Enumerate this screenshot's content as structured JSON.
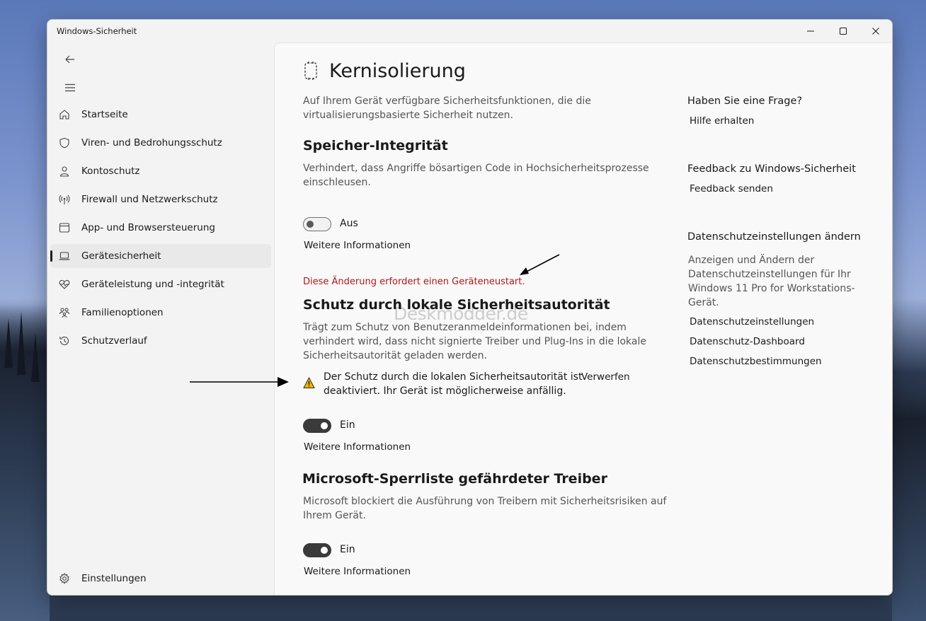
{
  "window": {
    "title": "Windows-Sicherheit",
    "controls": [
      "minimize-icon",
      "maximize-icon",
      "close-icon"
    ]
  },
  "nav": {
    "back_icon": "back-arrow-icon",
    "menu_icon": "hamburger-menu-icon",
    "items": [
      {
        "label": "Startseite",
        "icon": "home-icon"
      },
      {
        "label": "Viren- und Bedrohungsschutz",
        "icon": "shield-icon"
      },
      {
        "label": "Kontoschutz",
        "icon": "person-icon"
      },
      {
        "label": "Firewall und Netzwerkschutz",
        "icon": "antenna-icon"
      },
      {
        "label": "App- und Browsersteuerung",
        "icon": "browser-window-icon"
      },
      {
        "label": "Gerätesicherheit",
        "icon": "laptop-icon",
        "active": true
      },
      {
        "label": "Geräteleistung und -integrität",
        "icon": "heart-pulse-icon"
      },
      {
        "label": "Familienoptionen",
        "icon": "family-icon"
      },
      {
        "label": "Schutzverlauf",
        "icon": "history-icon"
      }
    ],
    "settings_label": "Einstellungen"
  },
  "main": {
    "title": "Kernisolierung",
    "intro": [
      "Auf Ihrem Gerät verfügbare Sicherheitsfunktionen, die die",
      "virtualisierungsbasierte Sicherheit nutzen."
    ],
    "memory_integrity": {
      "heading": "Speicher-Integrität",
      "desc": [
        "Verhindert, dass Angriffe bösartigen Code in Hochsicherheitsprozesse",
        "einschleusen."
      ],
      "toggle_state": "Aus",
      "more_info": "Weitere Informationen",
      "restart_notice": "Diese Änderung erfordert einen Geräteneustart."
    },
    "lsa": {
      "heading": "Schutz durch lokale Sicherheitsautorität",
      "desc": [
        "Trägt zum Schutz von Benutzeranmeldeinformationen bei, indem",
        "verhindert wird, dass nicht signierte Treiber und Plug-Ins in die lokale",
        "Sicherheitsautorität geladen werden."
      ],
      "warning": [
        "Der Schutz durch die lokalen Sicherheitsautorität ist",
        "deaktiviert. Ihr Gerät ist möglicherweise anfällig."
      ],
      "dismiss": "Verwerfen",
      "toggle_state": "Ein",
      "more_info": "Weitere Informationen"
    },
    "blocklist": {
      "heading": "Microsoft-Sperrliste gefährdeter Treiber",
      "desc": [
        "Microsoft blockiert die Ausführung von Treibern mit Sicherheitsrisiken auf",
        "Ihrem Gerät."
      ],
      "toggle_state": "Ein",
      "more_info": "Weitere Informationen"
    },
    "watermark": "Deskmodder.de"
  },
  "side": {
    "question_heading": "Haben Sie eine Frage?",
    "help_link": "Hilfe erhalten",
    "feedback_heading": "Feedback zu Windows-Sicherheit",
    "feedback_link": "Feedback senden",
    "privacy_heading": "Datenschutzeinstellungen ändern",
    "privacy_text": [
      "Anzeigen und Ändern der",
      "Datenschutzeinstellungen für Ihr",
      "Windows 11 Pro for Workstations-",
      "Gerät."
    ],
    "privacy_links": [
      "Datenschutzeinstellungen",
      "Datenschutz-Dashboard",
      "Datenschutzbestimmungen"
    ]
  },
  "colors": {
    "warning_red": "#b01818",
    "toggle_on": "#3a3a3a",
    "warning_yellow": "#f2b600"
  }
}
